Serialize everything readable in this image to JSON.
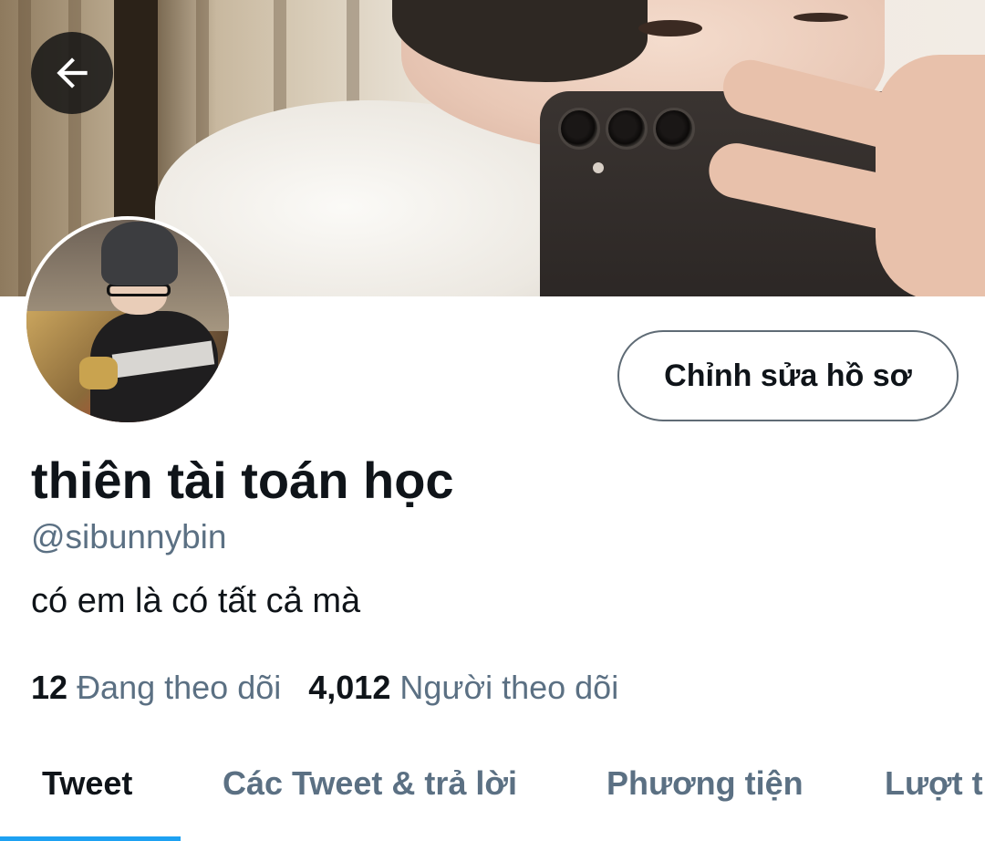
{
  "header": {
    "back_icon": "arrow-left-icon",
    "banner_image": "profile-banner-photo"
  },
  "profile": {
    "avatar_image": "profile-avatar-photo",
    "edit_button_label": "Chỉnh sửa hồ sơ",
    "display_name": "thiên tài toán học",
    "handle": "@sibunnybin",
    "bio": "có em là có tất cả mà",
    "following_count": "12",
    "following_label": "Đang theo dõi",
    "followers_count": "4,012",
    "followers_label": "Người theo dõi"
  },
  "tabs": [
    {
      "label": "Tweet",
      "active": true
    },
    {
      "label": "Các Tweet & trả lời",
      "active": false
    },
    {
      "label": "Phương tiện",
      "active": false
    },
    {
      "label": "Lượt thích",
      "active": false
    }
  ],
  "colors": {
    "accent": "#1da1f2",
    "text_primary": "#0f1419",
    "text_secondary": "#5b7083"
  }
}
